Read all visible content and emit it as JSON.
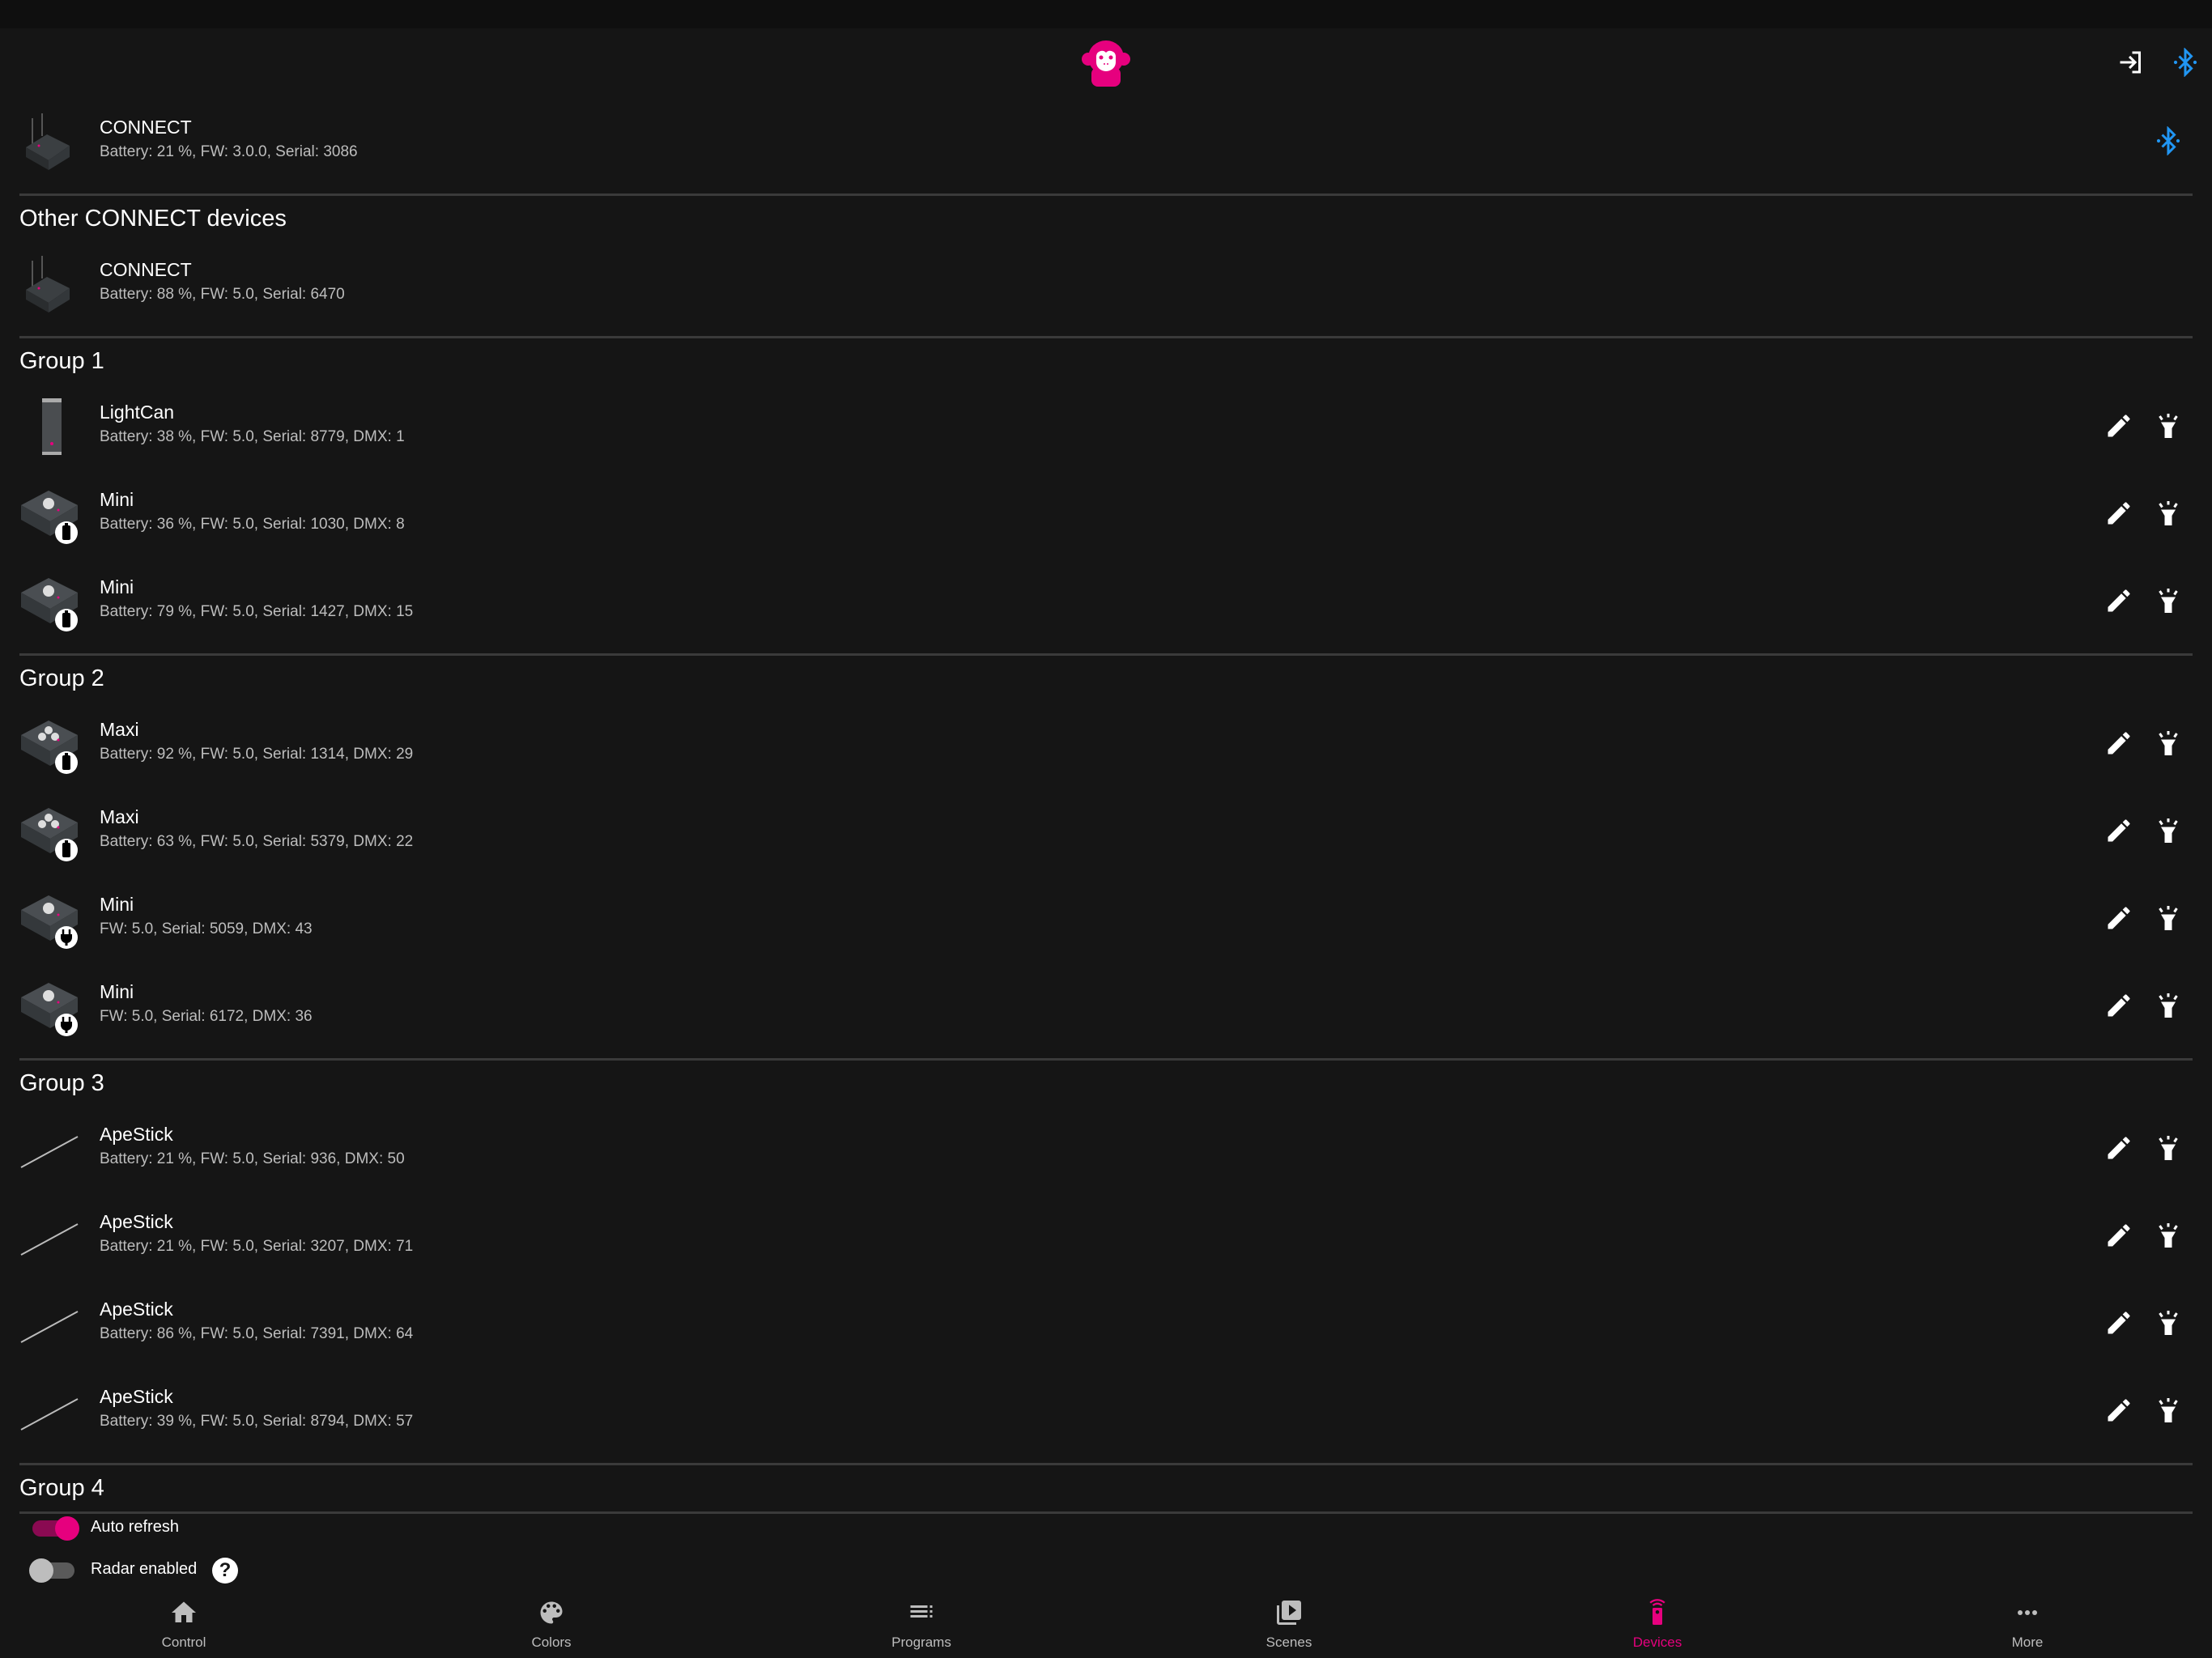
{
  "colors": {
    "accent": "#e6007e",
    "bluetooth": "#2196f3",
    "background": "#151515"
  },
  "header": {
    "logo": "monkey-logo",
    "icons": [
      "login-icon",
      "bluetooth-icon"
    ]
  },
  "connected": {
    "title": "CONNECT",
    "subtitle": "Battery: 21 %,  FW: 3.0.0,  Serial: 3086",
    "image": "connect",
    "action": "bluetooth-icon"
  },
  "sections": [
    {
      "heading": "Other CONNECT devices",
      "devices": [
        {
          "title": "CONNECT",
          "subtitle": "Battery: 88 %,  FW: 5.0,  Serial: 6470",
          "image": "connect",
          "badge": "",
          "actions": false
        }
      ]
    },
    {
      "heading": "Group 1",
      "devices": [
        {
          "title": "LightCan",
          "subtitle": "Battery: 38 %,  FW: 5.0,  Serial: 8779,  DMX: 1",
          "image": "lightcan",
          "badge": "",
          "actions": true
        },
        {
          "title": "Mini",
          "subtitle": "Battery: 36 %,  FW: 5.0,  Serial: 1030,  DMX: 8",
          "image": "mini",
          "badge": "battery",
          "actions": true
        },
        {
          "title": "Mini",
          "subtitle": "Battery: 79 %,  FW: 5.0,  Serial: 1427,  DMX: 15",
          "image": "mini",
          "badge": "battery",
          "actions": true
        }
      ]
    },
    {
      "heading": "Group 2",
      "devices": [
        {
          "title": "Maxi",
          "subtitle": "Battery: 92 %,  FW: 5.0,  Serial: 1314,  DMX: 29",
          "image": "maxi",
          "badge": "battery",
          "actions": true
        },
        {
          "title": "Maxi",
          "subtitle": "Battery: 63 %,  FW: 5.0,  Serial: 5379,  DMX: 22",
          "image": "maxi",
          "badge": "battery",
          "actions": true
        },
        {
          "title": "Mini",
          "subtitle": "FW: 5.0,  Serial: 5059,  DMX: 43",
          "image": "mini",
          "badge": "plug",
          "actions": true
        },
        {
          "title": "Mini",
          "subtitle": "FW: 5.0,  Serial: 6172,  DMX: 36",
          "image": "mini",
          "badge": "plug",
          "actions": true
        }
      ]
    },
    {
      "heading": "Group 3",
      "devices": [
        {
          "title": "ApeStick",
          "subtitle": "Battery: 21 %,  FW: 5.0,  Serial: 936,  DMX: 50",
          "image": "apestick",
          "badge": "",
          "actions": true
        },
        {
          "title": "ApeStick",
          "subtitle": "Battery: 21 %,  FW: 5.0,  Serial: 3207,  DMX: 71",
          "image": "apestick",
          "badge": "",
          "actions": true
        },
        {
          "title": "ApeStick",
          "subtitle": "Battery: 86 %,  FW: 5.0,  Serial: 7391,  DMX: 64",
          "image": "apestick",
          "badge": "",
          "actions": true
        },
        {
          "title": "ApeStick",
          "subtitle": "Battery: 39 %,  FW: 5.0,  Serial: 8794,  DMX: 57",
          "image": "apestick",
          "badge": "",
          "actions": true
        }
      ]
    },
    {
      "heading": "Group 4",
      "devices": []
    }
  ],
  "toggles": {
    "auto_refresh": {
      "label": "Auto refresh",
      "on": true
    },
    "radar": {
      "label": "Radar enabled",
      "on": false,
      "help": "?"
    }
  },
  "nav": [
    {
      "label": "Control",
      "icon": "home-icon",
      "active": false
    },
    {
      "label": "Colors",
      "icon": "palette-icon",
      "active": false
    },
    {
      "label": "Programs",
      "icon": "playlist-icon",
      "active": false
    },
    {
      "label": "Scenes",
      "icon": "video-library-icon",
      "active": false
    },
    {
      "label": "Devices",
      "icon": "remote-icon",
      "active": true
    },
    {
      "label": "More",
      "icon": "more-icon",
      "active": false
    }
  ]
}
